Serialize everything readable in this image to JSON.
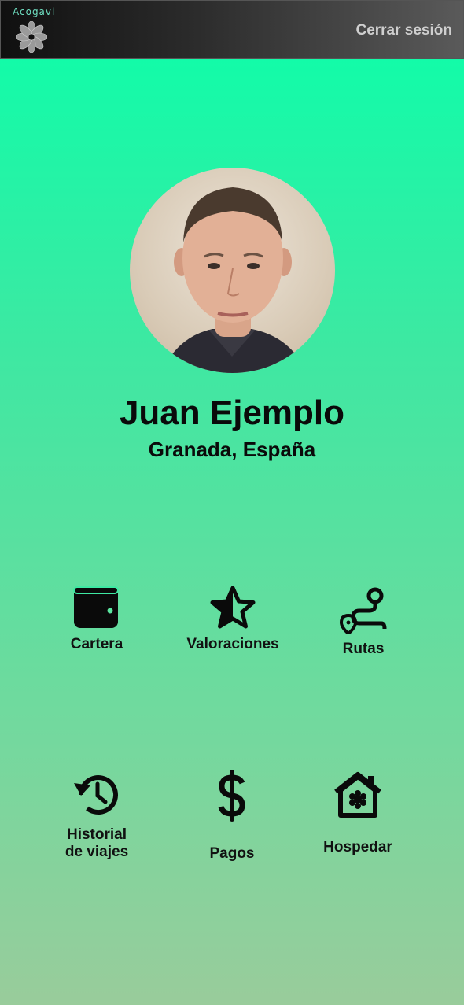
{
  "header": {
    "brand": "Acogavi",
    "logout_label": "Cerrar sesión"
  },
  "profile": {
    "name": "Juan Ejemplo",
    "location": "Granada, España"
  },
  "menu": {
    "wallet": "Cartera",
    "ratings": "Valoraciones",
    "routes": "Rutas",
    "history_line1": "Historial",
    "history_line2": "de viajes",
    "payments": "Pagos",
    "host": "Hospedar"
  },
  "colors": {
    "gradient_top": "#0affaa",
    "gradient_bottom": "#99cc9b",
    "topbar": "#1a1a1a",
    "brand_text": "#6fe0c2",
    "logout_text": "#cfcfcf"
  }
}
